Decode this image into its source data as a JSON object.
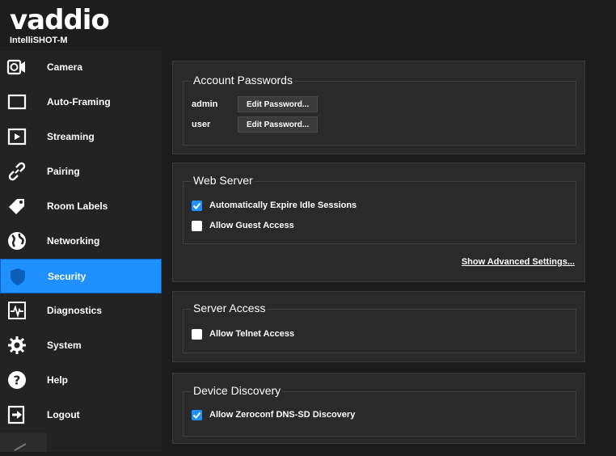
{
  "header": {
    "brand": "vaddio",
    "model": "IntelliSHOT-M"
  },
  "sidebar": {
    "items": [
      {
        "label": "Camera",
        "icon": "camera-icon"
      },
      {
        "label": "Auto-Framing",
        "icon": "frame-icon"
      },
      {
        "label": "Streaming",
        "icon": "play-icon"
      },
      {
        "label": "Pairing",
        "icon": "link-icon"
      },
      {
        "label": "Room Labels",
        "icon": "tag-icon"
      },
      {
        "label": "Networking",
        "icon": "globe-icon"
      },
      {
        "label": "Security",
        "icon": "shield-icon",
        "active": true
      },
      {
        "label": "Diagnostics",
        "icon": "pulse-icon"
      },
      {
        "label": "System",
        "icon": "gear-icon"
      },
      {
        "label": "Help",
        "icon": "help-icon"
      },
      {
        "label": "Logout",
        "icon": "logout-icon"
      }
    ]
  },
  "account_passwords": {
    "title": "Account Passwords",
    "rows": [
      {
        "user": "admin",
        "button": "Edit Password..."
      },
      {
        "user": "user",
        "button": "Edit Password..."
      }
    ]
  },
  "web_server": {
    "title": "Web Server",
    "options": [
      {
        "label": "Automatically Expire Idle Sessions",
        "checked": true
      },
      {
        "label": "Allow Guest Access",
        "checked": false
      }
    ],
    "advanced_link": "Show Advanced Settings..."
  },
  "server_access": {
    "title": "Server Access",
    "options": [
      {
        "label": "Allow Telnet Access",
        "checked": false
      }
    ]
  },
  "device_discovery": {
    "title": "Device Discovery",
    "options": [
      {
        "label": "Allow Zeroconf DNS-SD Discovery",
        "checked": true
      }
    ]
  },
  "colors": {
    "accent": "#1e90ff",
    "panel": "#2a2a2a",
    "background": "#1c1c1c"
  }
}
